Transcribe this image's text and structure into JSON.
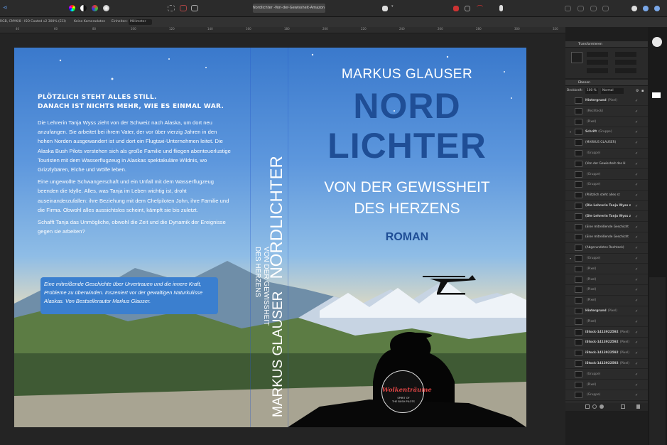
{
  "app": {
    "document_title": "Nordlichter -Von-der-Gewissheit-Amazon (2",
    "color_profile": "RGB, CMYK/8 - ISO Coated v2 300% (ECI)",
    "camera_label": "Keine Kameradaten",
    "units_label": "Einheiten:",
    "units_value": "Millimeter"
  },
  "ruler": {
    "ticks": [
      "40",
      "60",
      "80",
      "100",
      "120",
      "140",
      "160",
      "180",
      "200",
      "220",
      "240",
      "260",
      "280",
      "300",
      "320"
    ]
  },
  "cover": {
    "back": {
      "headline_1": "Plötzlich steht alles still.",
      "headline_2": "Danach ist nichts mehr, wie es einmal war.",
      "paragraphs": [
        "Die Lehrerin Tanja Wyss zieht von der Schweiz nach Alaska, um dort neu anzufangen. Sie arbeitet bei ihrem Vater, der vor über vierzig Jahren in den hohen Norden ausgewandert ist und dort ein Flugtaxi-Unternehmen leitet. Die Alaska Bush Pilots verstehen sich als große Familie und fliegen abenteuerlustige Touristen mit dem Wasserflugzeug in Alaskas spektakuläre Wildnis, wo Grizzlybären, Elche und Wölfe leben.",
        "Eine ungewollte Schwangerschaft und ein Unfall mit dem Wasserflugzeug beenden die Idylle. Alles, was Tanja im Leben wichtig ist, droht auseinanderzufallen: ihre Beziehung mit dem Chefpiloten John, ihre Familie und die Firma. Obwohl alles aussichtslos scheint, kämpft sie bis zuletzt.",
        "Schafft Tanja das Unmögliche, obwohl die Zeit und die Dynamik der Ereignisse gegen sie arbeiten?"
      ],
      "teaser": "Eine mitreißende Geschichte über Urvertrauen und die innere Kraft, Probleme zu überwinden. Inszeniert vor der gewaltigen Naturkulisse Alaskas. Von Bestsellerautor Markus Glauser."
    },
    "spine": {
      "author": "MARKUS GLAUSER",
      "title": "NORDLICHTER",
      "subtitle_1": "VON DER GEWISSHEIT",
      "subtitle_2": "DES HERZENS"
    },
    "front": {
      "author": "MARKUS GLAUSER",
      "title_1": "NORD",
      "title_2": "LICHTER",
      "subtitle_1": "VON DER GEWISSHEIT",
      "subtitle_2": "DES HERZENS",
      "genre": "ROMAN"
    },
    "logo": {
      "title": "Wolkenträume",
      "sub_1": "SPIRIT OF",
      "sub_2": "THE BUSH PILOTS"
    }
  },
  "panels": {
    "transform_title": "Transformieren",
    "layers_title": "Ebenen",
    "opacity_label": "Deckkraft:",
    "opacity_value": "100 %",
    "blend_mode": "Normal",
    "layers": [
      {
        "name": "Hintergrund",
        "kind": "(Pixel)",
        "bold": true
      },
      {
        "name": "",
        "kind": "(Rechteck)",
        "bold": false
      },
      {
        "name": "",
        "kind": "(Pixel)",
        "bold": false
      },
      {
        "name": "Schrift",
        "kind": "(Gruppe)",
        "bold": true
      },
      {
        "name": "(MARKUS GLAUSER)",
        "kind": "",
        "bold": false
      },
      {
        "name": "",
        "kind": "(Gruppe)",
        "bold": false
      },
      {
        "name": "(Von der Gewissheit des H",
        "kind": "",
        "bold": false
      },
      {
        "name": "",
        "kind": "(Gruppe)",
        "bold": false
      },
      {
        "name": "",
        "kind": "(Gruppe)",
        "bold": false
      },
      {
        "name": "(Plötzlich steht alles st",
        "kind": "",
        "bold": false
      },
      {
        "name": "(Die Lehrerin Tanja Wyss z",
        "kind": "",
        "bold": true
      },
      {
        "name": "(Die Lehrerin Tanja Wyss z",
        "kind": "",
        "bold": true
      },
      {
        "name": "(Eine mitreißende Geschicht",
        "kind": "",
        "bold": false
      },
      {
        "name": "(Eine mitreißende Geschicht",
        "kind": "",
        "bold": false
      },
      {
        "name": "(Abgerundetes Rechteck)",
        "kind": "",
        "bold": false
      },
      {
        "name": "",
        "kind": "(Gruppe)",
        "bold": false
      },
      {
        "name": "",
        "kind": "(Pixel)",
        "bold": false
      },
      {
        "name": "",
        "kind": "(Pixel)",
        "bold": false
      },
      {
        "name": "",
        "kind": "(Pixel)",
        "bold": false
      },
      {
        "name": "",
        "kind": "(Pixel)",
        "bold": false
      },
      {
        "name": "Hintergrund",
        "kind": "(Pixel)",
        "bold": true
      },
      {
        "name": "",
        "kind": "(Pixel)",
        "bold": false
      },
      {
        "name": "iStock-1413922592",
        "kind": "(Pixel)",
        "bold": true
      },
      {
        "name": "iStock-1413922592",
        "kind": "(Pixel)",
        "bold": true
      },
      {
        "name": "iStock-1413922592",
        "kind": "(Pixel)",
        "bold": true
      },
      {
        "name": "iStock-1413922592",
        "kind": "(Pixel)",
        "bold": true
      },
      {
        "name": "",
        "kind": "(Gruppe)",
        "bold": false
      },
      {
        "name": "",
        "kind": "(Pixel)",
        "bold": false
      },
      {
        "name": "",
        "kind": "(Gruppe)",
        "bold": false
      }
    ]
  }
}
